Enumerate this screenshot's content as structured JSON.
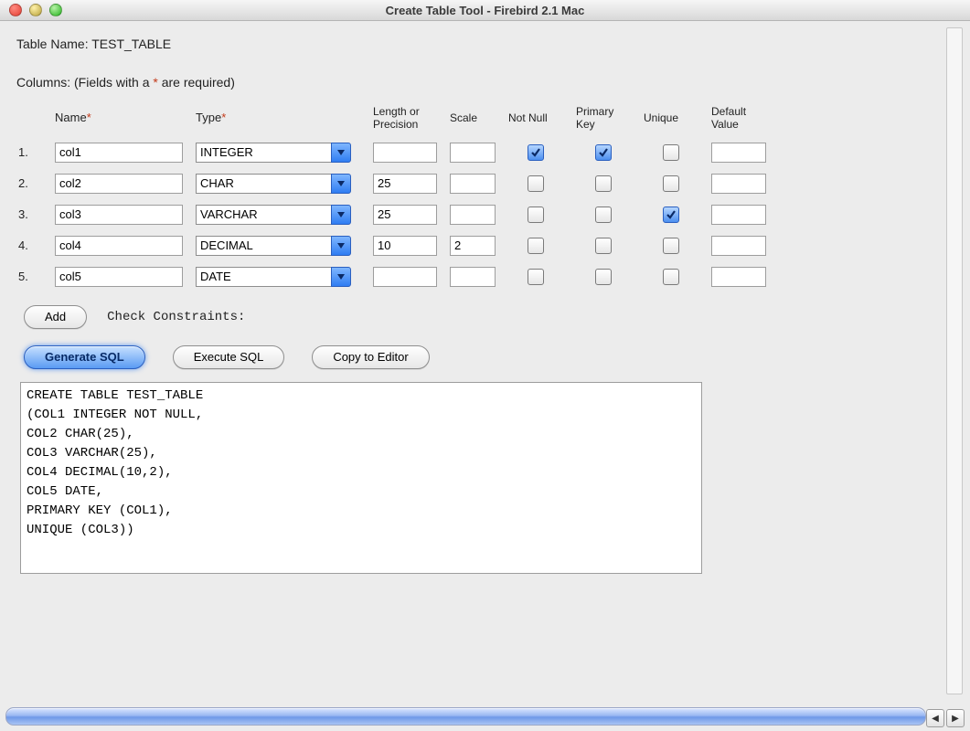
{
  "window": {
    "title": "Create Table Tool - Firebird 2.1 Mac"
  },
  "table_name_label": "Table Name:",
  "table_name": "TEST_TABLE",
  "columns_hint_prefix": "Columns: (Fields with a ",
  "columns_hint_ast": "*",
  "columns_hint_suffix": " are required)",
  "headers": {
    "name": "Name",
    "type": "Type",
    "length": "Length or Precision",
    "scale": "Scale",
    "notnull": "Not Null",
    "pk": "Primary Key",
    "unique": "Unique",
    "default": "Default Value"
  },
  "asterisk": "*",
  "rows": [
    {
      "n": "1.",
      "name": "col1",
      "type": "INTEGER",
      "length": "",
      "scale": "",
      "notnull": true,
      "pk": true,
      "unique": false,
      "def": ""
    },
    {
      "n": "2.",
      "name": "col2",
      "type": "CHAR",
      "length": "25",
      "scale": "",
      "notnull": false,
      "pk": false,
      "unique": false,
      "def": ""
    },
    {
      "n": "3.",
      "name": "col3",
      "type": "VARCHAR",
      "length": "25",
      "scale": "",
      "notnull": false,
      "pk": false,
      "unique": true,
      "def": ""
    },
    {
      "n": "4.",
      "name": "col4",
      "type": "DECIMAL",
      "length": "10",
      "scale": "2",
      "notnull": false,
      "pk": false,
      "unique": false,
      "def": ""
    },
    {
      "n": "5.",
      "name": "col5",
      "type": "DATE",
      "length": "",
      "scale": "",
      "notnull": false,
      "pk": false,
      "unique": false,
      "def": ""
    }
  ],
  "buttons": {
    "add": "Add",
    "check_constraints": "Check Constraints:",
    "generate": "Generate SQL",
    "execute": "Execute SQL",
    "copy": "Copy to Editor"
  },
  "sql": "CREATE TABLE TEST_TABLE\n(COL1 INTEGER NOT NULL,\nCOL2 CHAR(25),\nCOL3 VARCHAR(25),\nCOL4 DECIMAL(10,2),\nCOL5 DATE,\nPRIMARY KEY (COL1),\nUNIQUE (COL3))"
}
